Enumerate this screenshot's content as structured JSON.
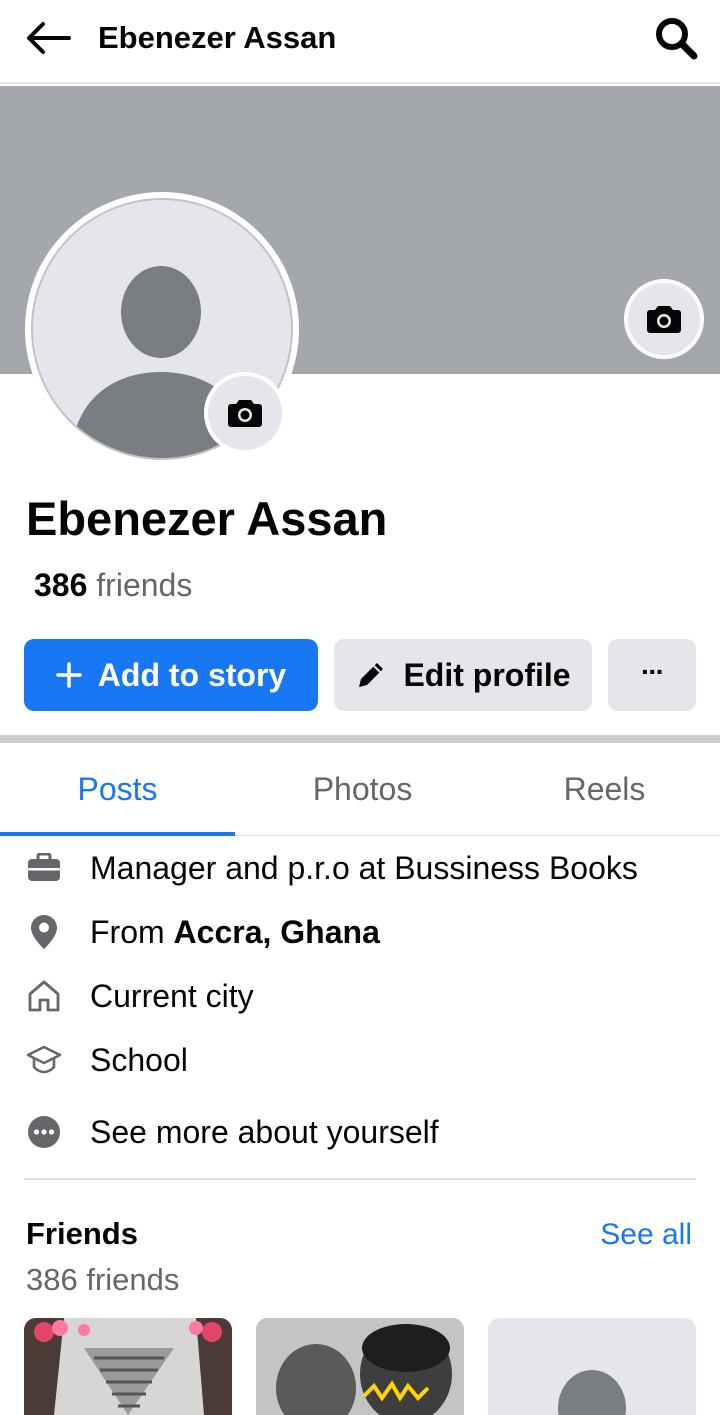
{
  "header": {
    "title": "Ebenezer Assan",
    "back_icon": "arrow-left-icon",
    "search_icon": "search-icon"
  },
  "profile": {
    "name": "Ebenezer Assan",
    "friends_count": "386",
    "friends_label": "friends"
  },
  "actions": {
    "add_story": "Add to story",
    "edit_profile": "Edit profile",
    "more": "···"
  },
  "tabs": [
    {
      "label": "Posts",
      "active": true
    },
    {
      "label": "Photos",
      "active": false
    },
    {
      "label": "Reels",
      "active": false
    }
  ],
  "details": {
    "work": "Manager and p.r.o at Bussiness Books",
    "from_prefix": "From ",
    "from_place": "Accra, Ghana",
    "current_city": "Current city",
    "school": "School",
    "see_more": "See more about yourself"
  },
  "friends_section": {
    "title": "Friends",
    "see_all": "See all",
    "count_text": "386 friends"
  },
  "colors": {
    "accent": "#1877f2",
    "cover": "#a4a7ac",
    "button_gray": "#e4e6eb"
  }
}
